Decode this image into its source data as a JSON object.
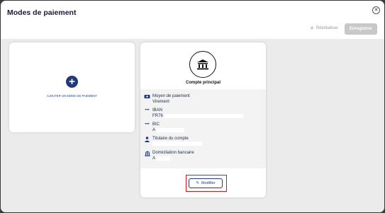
{
  "modal": {
    "title": "Modes de paiement",
    "close_icon": "close-icon"
  },
  "toolbar": {
    "reset_label": "Réinitialiser",
    "save_label": "Enregistrer"
  },
  "add_card": {
    "label": "AJOUTER UN MODE DE PAIEMENT",
    "icon": "plus-circle-icon"
  },
  "account_card": {
    "icon": "bank-icon",
    "title": "Compte principal",
    "fields": [
      {
        "label": "Moyen de paiement",
        "value": "Virement",
        "icon": "money-icon"
      },
      {
        "label": "IBAN",
        "value": "FR76",
        "icon": "dots-icon"
      },
      {
        "label": "BIC",
        "value": "A",
        "icon": "dots-icon"
      },
      {
        "label": "Titulaire du compte",
        "value": "",
        "icon": "user-icon"
      },
      {
        "label": "Domiciliation bancaire",
        "value": "A",
        "icon": "bank-icon"
      }
    ],
    "modify_label": "Modifier"
  },
  "colors": {
    "accent": "#1e3a78",
    "highlight": "#e01414",
    "disabled_button": "#c8c8c8",
    "background": "#ebebeb"
  }
}
